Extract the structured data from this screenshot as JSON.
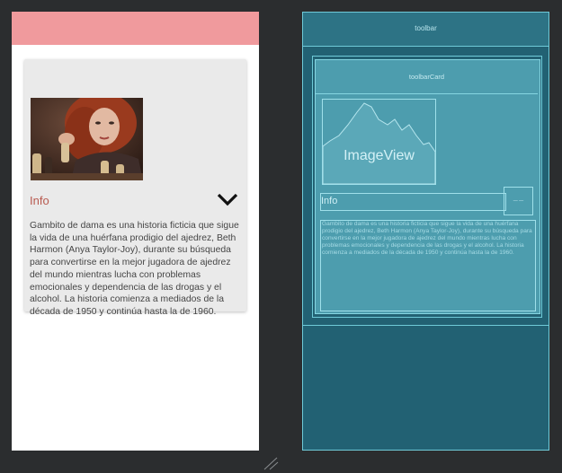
{
  "design": {
    "info_label": "Info",
    "description": "Gambito de dama es una historia ficticia que sigue la vida de una huérfana prodigio del ajedrez, Beth Harmon (Anya Taylor-Joy), durante su búsqueda para convertirse en la mejor jugadora de ajedrez del mundo mientras lucha con problemas emocionales y dependencia de las drogas y el alcohol. La historia comienza a mediados de la década de 1950 y continúa hasta la de 1960.",
    "toolbar_color": "#f09a9d",
    "label_color": "#b85a4f",
    "icons": {
      "expand": "chevron-down-icon"
    }
  },
  "blueprint": {
    "toolbar_label": "toolbar",
    "card_toolbar_label": "toolbarCard",
    "image_label": "ImageView",
    "info_label": "Info",
    "chevron_label": "— —",
    "description": "Gambito de dama es una historia ficticia que sigue la vida de una huérfana prodigio del ajedrez, Beth Harmon (Anya Taylor-Joy), durante su búsqueda para convertirse en la mejor jugadora de ajedrez del mundo mientras lucha con problemas emocionales y dependencia de las drogas y el alcohol. La historia comienza a mediados de la década de 1950 y continúa hasta la de 1960.",
    "background_color": "#226173",
    "outline_color": "#6fcad8"
  }
}
